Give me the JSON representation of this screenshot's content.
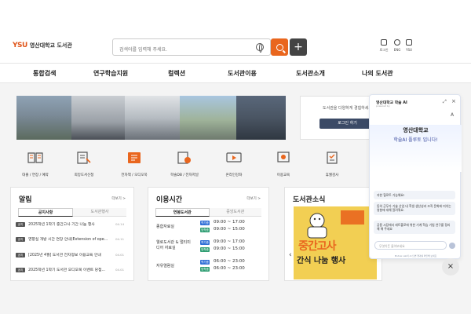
{
  "brand": {
    "logo_mark": "YSU",
    "logo_text": "영산대학교 도서관"
  },
  "search": {
    "placeholder": "검색어를 입력해 주세요."
  },
  "utilities": [
    {
      "label": "로그인"
    },
    {
      "label": "ENG"
    },
    {
      "label": "YSU"
    }
  ],
  "nav": [
    "통합검색",
    "연구학습지원",
    "컬렉션",
    "도서관이용",
    "도서관소개",
    "나의 도서관"
  ],
  "login": {
    "text": "도서관을 다양하게 경험하세요",
    "button": "로그인 하기"
  },
  "quick_menu": [
    {
      "label": "대출 / 연장 / 예약",
      "icon": "book-open-icon"
    },
    {
      "label": "희망도서신청",
      "icon": "book-request-icon"
    },
    {
      "label": "전자책 / 오디오북",
      "icon": "ebook-icon"
    },
    {
      "label": "학술DB / 전자저널",
      "icon": "database-icon"
    },
    {
      "label": "온라인강좌",
      "icon": "video-lecture-icon"
    },
    {
      "label": "이용교육",
      "icon": "education-icon"
    },
    {
      "label": "휴퀄검사",
      "icon": "test-icon"
    }
  ],
  "notices": {
    "title": "알림",
    "more": "더보기 >",
    "tabs": [
      "공지사항",
      "도서관행사"
    ],
    "items": [
      {
        "badge": "공지",
        "title": "2025학년 1학기 중간고사 기간 나눔 행사",
        "date": "04.14"
      },
      {
        "badge": "공지",
        "title": "영향실 개방 시간 연장 안내(Extension of ope...",
        "date": "04.11"
      },
      {
        "badge": "공지",
        "title": "[2025년 4월] 도서관 전자정보 이용교육 안내",
        "date": "04.01"
      },
      {
        "badge": "공지",
        "title": "2025학년 1학기 도서관 오디오북 이벤트 당첨...",
        "date": "04.01"
      }
    ]
  },
  "hours": {
    "title": "이용시간",
    "more": "더보기 >",
    "tabs": [
      "연봉도서관",
      "중앙도서관"
    ],
    "rows": [
      {
        "name": "종합자료실",
        "badges": [
          "학기중",
          "방학중"
        ],
        "times": [
          "09:00 ~ 17:00",
          "09:00 ~ 15:00"
        ]
      },
      {
        "name": "웰로도서관 & 멀티미디어 자료실",
        "badges": [
          "학기중",
          "방학중"
        ],
        "times": [
          "09:00 ~ 17:00",
          "09:00 ~ 15:00"
        ]
      },
      {
        "name": "자유열람실",
        "badges": [
          "학기중",
          "방학중"
        ],
        "times": [
          "06:00 ~ 23:00",
          "06:00 ~ 23:00"
        ]
      }
    ],
    "badge_colors": [
      "#2f6fd6",
      "#2f9e73"
    ]
  },
  "news": {
    "title": "도서관소식",
    "more": "더보기 >",
    "banner_text": "중간고사",
    "banner_sub": "간식 나눔 행사"
  },
  "chat": {
    "title": "영산대학교 학술 AI",
    "powered": "powered by",
    "hero_line1": "영산대학교",
    "hero_line2": "학술AI 플루토 입니다!",
    "msg1": "자한 힐로트 가능해요!",
    "msg2": "동의 군무가 기술 산업 내 학생 생산성과 조직 문화에 미치는 영향에 대해 알려줘요.",
    "msg3": "공용 시장에서 레트폴로에 위한 기계 학습 기법 연구를 정리해 해 주세요",
    "input_placeholder": "무엇이든 물어보세요",
    "footer": "Plutoai Lab이 AI 답변 결과를 확인해 보세요"
  },
  "colors": {
    "accent": "#e9661e",
    "navy": "#3b4a66"
  }
}
